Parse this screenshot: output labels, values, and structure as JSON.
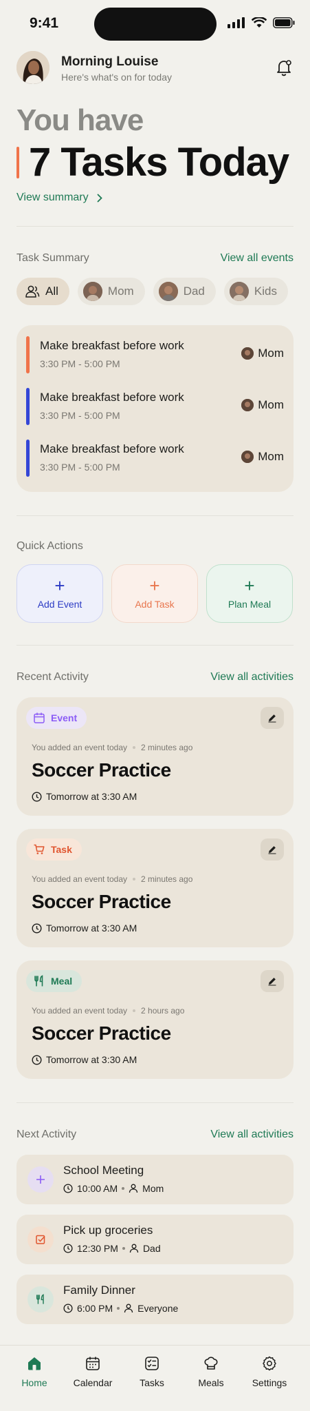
{
  "status": {
    "time": "9:41"
  },
  "header": {
    "greeting": "Morning Louise",
    "subtitle": "Here's what's on for today"
  },
  "hero": {
    "line1": "You have",
    "line2": "7 Tasks Today",
    "link": "View summary"
  },
  "task_summary": {
    "title": "Task Summary",
    "link": "View all events",
    "filters": [
      "All",
      "Mom",
      "Dad",
      "Kids"
    ],
    "tasks": [
      {
        "title": "Make breakfast before work",
        "time": "3:30 PM - 5:00 PM",
        "who": "Mom",
        "color": "#f0734a"
      },
      {
        "title": "Make breakfast before work",
        "time": "3:30 PM - 5:00 PM",
        "who": "Mom",
        "color": "#3446d6"
      },
      {
        "title": "Make breakfast before work",
        "time": "3:30 PM - 5:00 PM",
        "who": "Mom",
        "color": "#3446d6"
      }
    ]
  },
  "quick_actions": {
    "title": "Quick Actions",
    "items": [
      {
        "label": "Add Event",
        "icon": "plus-icon",
        "color": "#2c3bc4",
        "bg": "#eef0fb"
      },
      {
        "label": "Add Task",
        "icon": "plus-icon",
        "color": "#e8764e",
        "bg": "#fbf0ea"
      },
      {
        "label": "Plan Meal",
        "icon": "plus-icon",
        "color": "#1f7a55",
        "bg": "#ebf5ee"
      }
    ]
  },
  "recent": {
    "title": "Recent Activity",
    "link": "View all activities",
    "items": [
      {
        "badge": "Event",
        "meta": "You added an event today",
        "ago": "2 minutes ago",
        "title": "Soccer Practice",
        "when": "Tomorrow at 3:30 AM"
      },
      {
        "badge": "Task",
        "meta": "You added an event today",
        "ago": "2 minutes ago",
        "title": "Soccer Practice",
        "when": "Tomorrow at 3:30 AM"
      },
      {
        "badge": "Meal",
        "meta": "You added an event today",
        "ago": "2 hours ago",
        "title": "Soccer Practice",
        "when": "Tomorrow at 3:30 AM"
      }
    ]
  },
  "next": {
    "title": "Next Activity",
    "link": "View all activities",
    "items": [
      {
        "title": "School Meeting",
        "time": "10:00 AM",
        "who": "Mom"
      },
      {
        "title": "Pick up groceries",
        "time": "12:30 PM",
        "who": "Dad"
      },
      {
        "title": "Family Dinner",
        "time": "6:00 PM",
        "who": "Everyone"
      }
    ]
  },
  "tabs": [
    "Home",
    "Calendar",
    "Tasks",
    "Meals",
    "Settings"
  ],
  "colors": {
    "accent": "#1f7a55",
    "orange": "#f0734a",
    "blue": "#3446d6",
    "purple": "#8b5cf6"
  }
}
